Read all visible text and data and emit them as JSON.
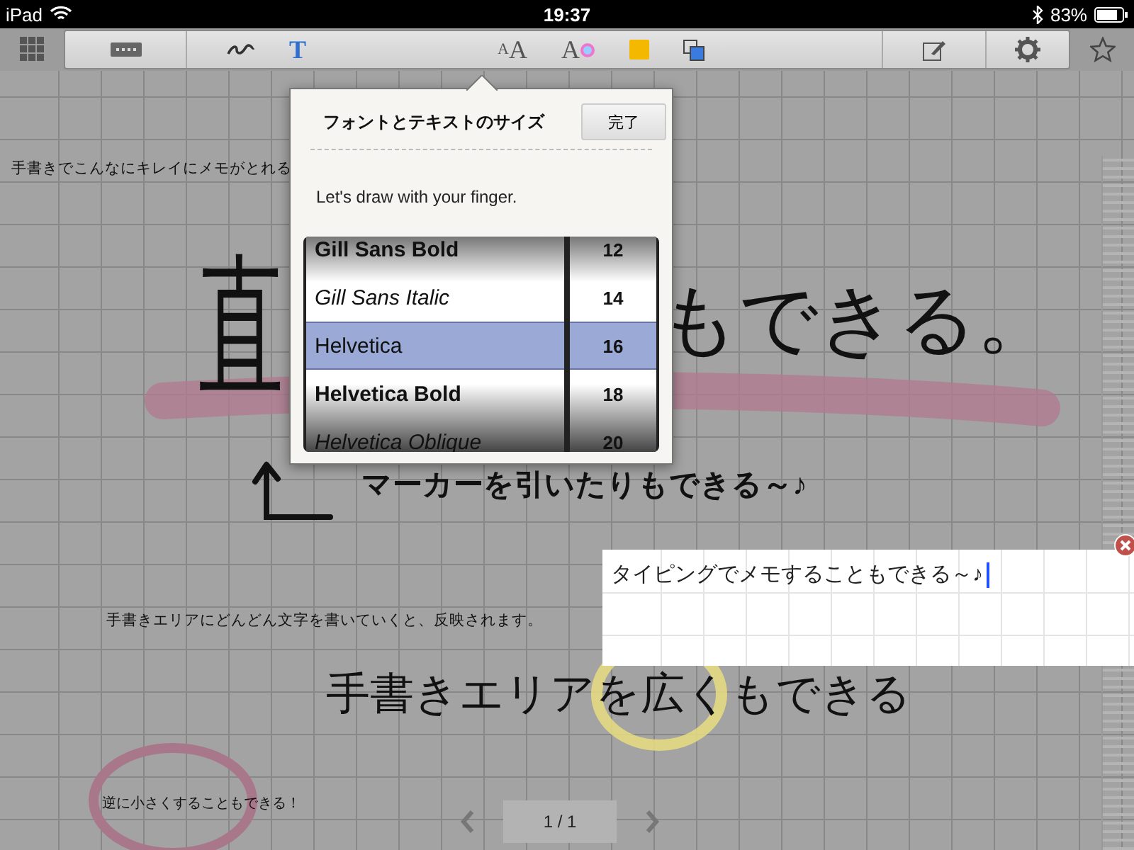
{
  "status_bar": {
    "device": "iPad",
    "time": "19:37",
    "battery": "83%"
  },
  "toolbar": {
    "tools": [
      {
        "kind": "keyboard"
      },
      {
        "kind": "pen"
      },
      {
        "kind": "text",
        "glyph": "T"
      },
      {
        "kind": "font",
        "glyph": "AA"
      },
      {
        "kind": "color",
        "glyph": "A"
      },
      {
        "kind": "note"
      },
      {
        "kind": "layers"
      }
    ]
  },
  "popover": {
    "title": "フォントとテキストのサイズ",
    "done_button": "完了",
    "preview": "Let's draw with your finger.",
    "fonts": [
      {
        "label": "Gill Sans Bold",
        "kind": "bold",
        "selected": false
      },
      {
        "label": "Gill Sans Italic",
        "kind": "italic",
        "selected": false
      },
      {
        "label": "Helvetica",
        "kind": "regular",
        "selected": true
      },
      {
        "label": "Helvetica Bold",
        "kind": "bold",
        "selected": false
      },
      {
        "label": "Helvetica Oblique",
        "kind": "italic",
        "selected": false
      }
    ],
    "sizes": [
      {
        "label": "12",
        "selected": false
      },
      {
        "label": "14",
        "selected": false
      },
      {
        "label": "16",
        "selected": true
      },
      {
        "label": "18",
        "selected": false
      },
      {
        "label": "20",
        "selected": false
      }
    ]
  },
  "canvas": {
    "notes": [
      "手書きでこんなにキレイにメモがとれる",
      "直",
      "もできる。",
      "マーカーを引いたりもできる～♪",
      "手書きエリアにどんどん文字を書いていくと、反映されます。",
      "手書きエリアを広くもできる",
      "逆に小さくすることもできる！"
    ],
    "text_box": {
      "value": "タイピングでメモすることもできる～♪"
    }
  },
  "page_indicator": "1 / 1"
}
